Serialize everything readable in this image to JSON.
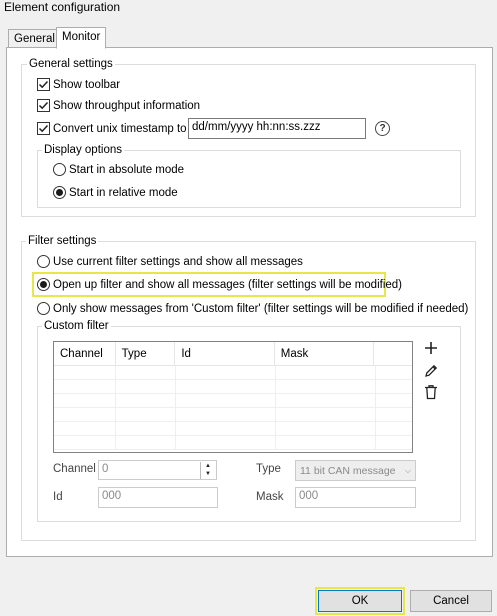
{
  "window": {
    "title": "Element configuration"
  },
  "tabs": [
    {
      "label": "General",
      "active": false
    },
    {
      "label": "Monitor",
      "active": true
    }
  ],
  "general_settings": {
    "legend": "General settings",
    "show_toolbar": {
      "label": "Show toolbar",
      "checked": true
    },
    "show_throughput": {
      "label": "Show throughput information",
      "checked": true
    },
    "convert_timestamp": {
      "label": "Convert unix timestamp to",
      "checked": true,
      "value": "dd/mm/yyyy hh:nn:ss.zzz"
    },
    "help_icon": "?",
    "display_options": {
      "legend": "Display options",
      "absolute": {
        "label": "Start in absolute mode",
        "selected": false
      },
      "relative": {
        "label": "Start in relative mode",
        "selected": true
      }
    }
  },
  "filter_settings": {
    "legend": "Filter settings",
    "options": [
      {
        "label": "Use current filter settings and show all messages",
        "selected": false
      },
      {
        "label": "Open up filter and show all messages (filter settings will be modified)",
        "selected": true
      },
      {
        "label": "Only show messages from 'Custom filter' (filter settings will be modified if needed)",
        "selected": false
      }
    ],
    "custom_filter": {
      "legend": "Custom filter",
      "columns": [
        "Channel",
        "Type",
        "Id",
        "Mask"
      ],
      "rows": [],
      "channel_label": "Channel",
      "channel_value": "0",
      "type_label": "Type",
      "type_value": "11 bit CAN message",
      "id_label": "Id",
      "id_value": "000",
      "mask_label": "Mask",
      "mask_value": "000"
    }
  },
  "buttons": {
    "ok": "OK",
    "cancel": "Cancel"
  },
  "colors": {
    "highlight": "#e6e84a",
    "default_button_border": "#0078d7"
  }
}
